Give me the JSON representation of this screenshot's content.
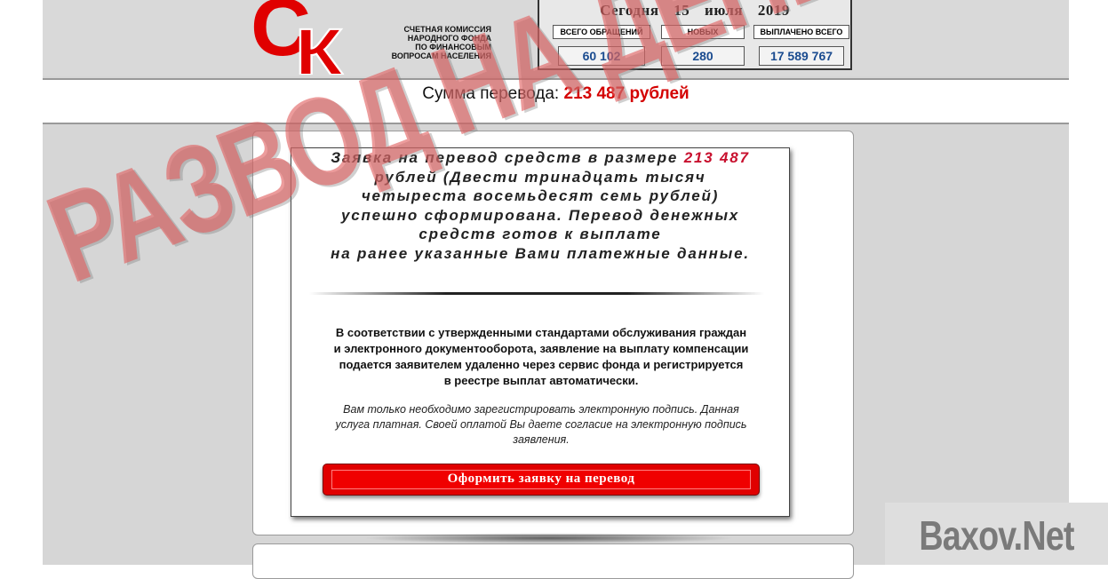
{
  "header": {
    "logo_letters": "СК",
    "org_lines": [
      "СЧЕТНАЯ КОМИССИЯ",
      "НАРОДНОГО ФОНДА",
      "ПО ФИНАНСОВЫМ",
      "ВОПРОСАМ НАСЕЛЕНИЯ"
    ],
    "date": {
      "prefix": "Сегодня",
      "day": "15",
      "month": "июля",
      "year": "2019"
    },
    "stats": [
      {
        "label": "ВСЕГО ОБРАЩЕНИЙ",
        "value": "60 102"
      },
      {
        "label": "НОВЫХ",
        "value": "280"
      },
      {
        "label": "ВЫПЛАЧЕНО ВСЕГО",
        "value": "17 589 767"
      }
    ]
  },
  "amount": {
    "label": "Сумма перевода:",
    "value": "213 487 рублей"
  },
  "card": {
    "headline": {
      "line1_a": "Заявка на перевод средств в размере",
      "line1_amount": "213 487",
      "line2": "рублей (Двести тринадцать тысяч",
      "line3": "четыреста восемьдесят семь рублей)",
      "line4": "успешно сформирована. Перевод денежных",
      "line5": "средств готов к выплате",
      "line6": "на ранее указанные Вами платежные данные."
    },
    "body_lines": [
      "В соответствии с утвержденными стандартами обслуживания граждан",
      "и электронного документооборота, заявление на выплату компенсации",
      "подается заявителем удаленно через сервис фонда и регистрируется",
      "в реестре выплат автоматически."
    ],
    "note_lines": [
      "Вам только необходимо зарегистрировать электронную подпись. Данная",
      "услуга платная. Своей оплатой Вы даете согласие на электронную подпись",
      "заявления."
    ],
    "cta_label": "Оформить заявку на перевод"
  },
  "watermarks": {
    "stamp": "РАЗВОД НА ДЕНЬГИ",
    "site": "Baxov.Net"
  },
  "colors": {
    "accent_red": "#e00000",
    "value_blue": "#1a4b8f",
    "stamp_red": "#e06060"
  }
}
